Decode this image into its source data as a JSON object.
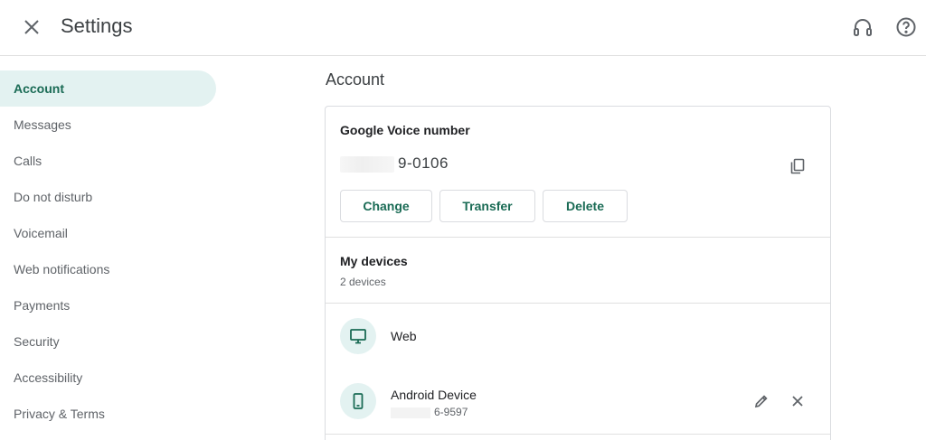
{
  "header": {
    "title": "Settings",
    "close_icon": "close-icon",
    "support_icon": "headset-icon",
    "help_icon": "help-icon"
  },
  "sidebar": {
    "items": [
      {
        "label": "Account",
        "active": true
      },
      {
        "label": "Messages"
      },
      {
        "label": "Calls"
      },
      {
        "label": "Do not disturb"
      },
      {
        "label": "Voicemail"
      },
      {
        "label": "Web notifications"
      },
      {
        "label": "Payments"
      },
      {
        "label": "Security"
      },
      {
        "label": "Accessibility"
      },
      {
        "label": "Privacy & Terms"
      }
    ]
  },
  "account": {
    "section_title": "Account",
    "voice_number": {
      "title": "Google Voice number",
      "number_visible": "9-0106",
      "copy_icon": "copy-icon",
      "buttons": {
        "change": "Change",
        "transfer": "Transfer",
        "delete": "Delete"
      }
    },
    "devices": {
      "title": "My devices",
      "count": "2 devices",
      "list": [
        {
          "name": "Web",
          "icon": "monitor-icon"
        },
        {
          "name": "Android Device",
          "sub": "6-9597",
          "icon": "phone-icon"
        }
      ]
    }
  },
  "colors": {
    "accent": "#1a6b55",
    "active_bg": "#e3f2f1",
    "border": "#dadce0"
  }
}
